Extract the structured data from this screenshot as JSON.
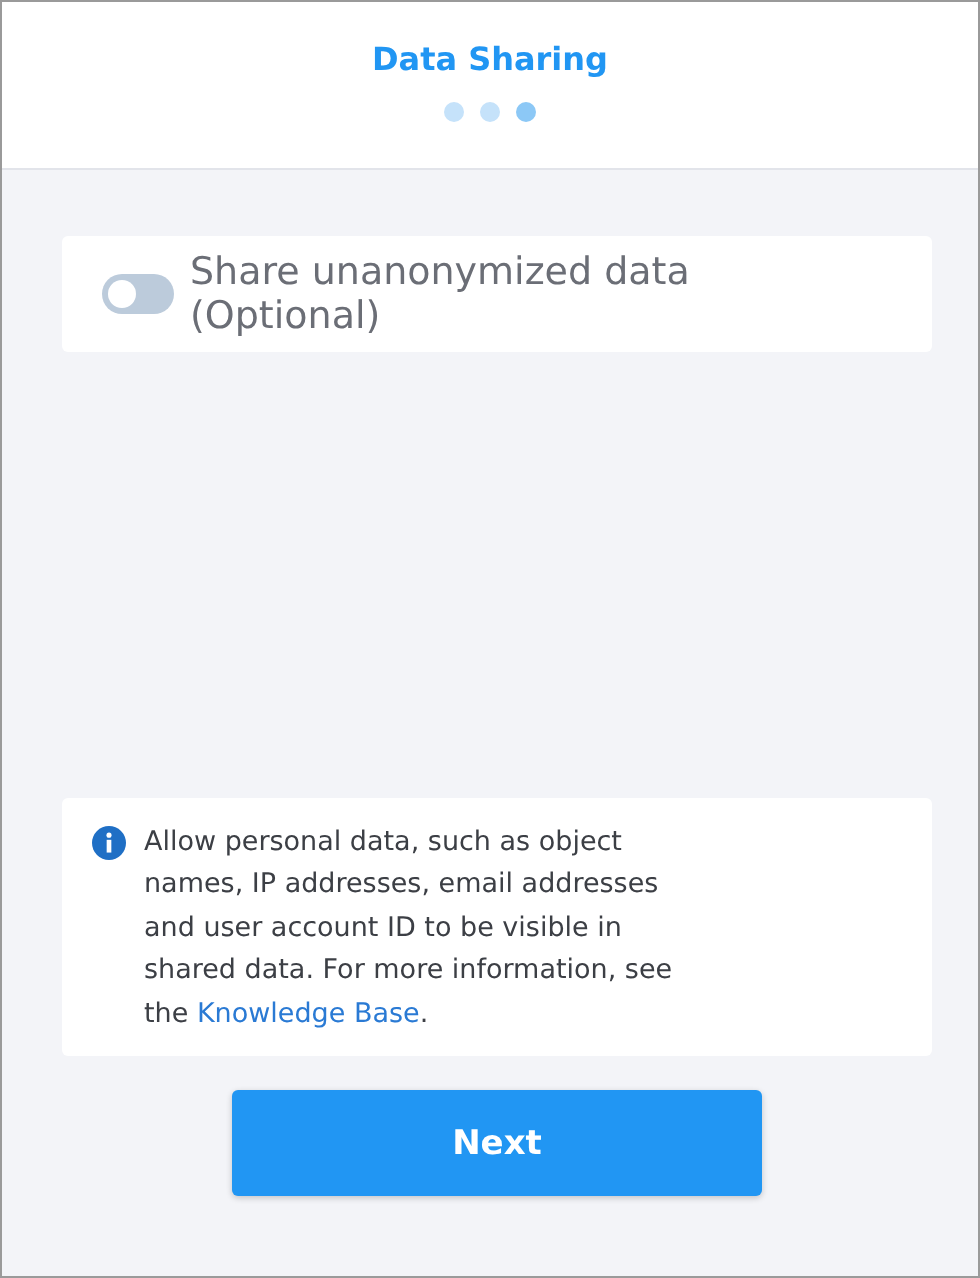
{
  "header": {
    "title": "Data Sharing",
    "steps": [
      {
        "selected": false
      },
      {
        "selected": false
      },
      {
        "selected": true
      }
    ]
  },
  "toggle": {
    "label": "Share unanonymized data (Optional)",
    "on": false
  },
  "info": {
    "text_before": "Allow personal data, such as object names, IP addresses, email addresses and user account ID to be visible in shared data. For more information, see the ",
    "link": "Knowledge Base",
    "text_after": "."
  },
  "buttons": [
    "Next"
  ]
}
